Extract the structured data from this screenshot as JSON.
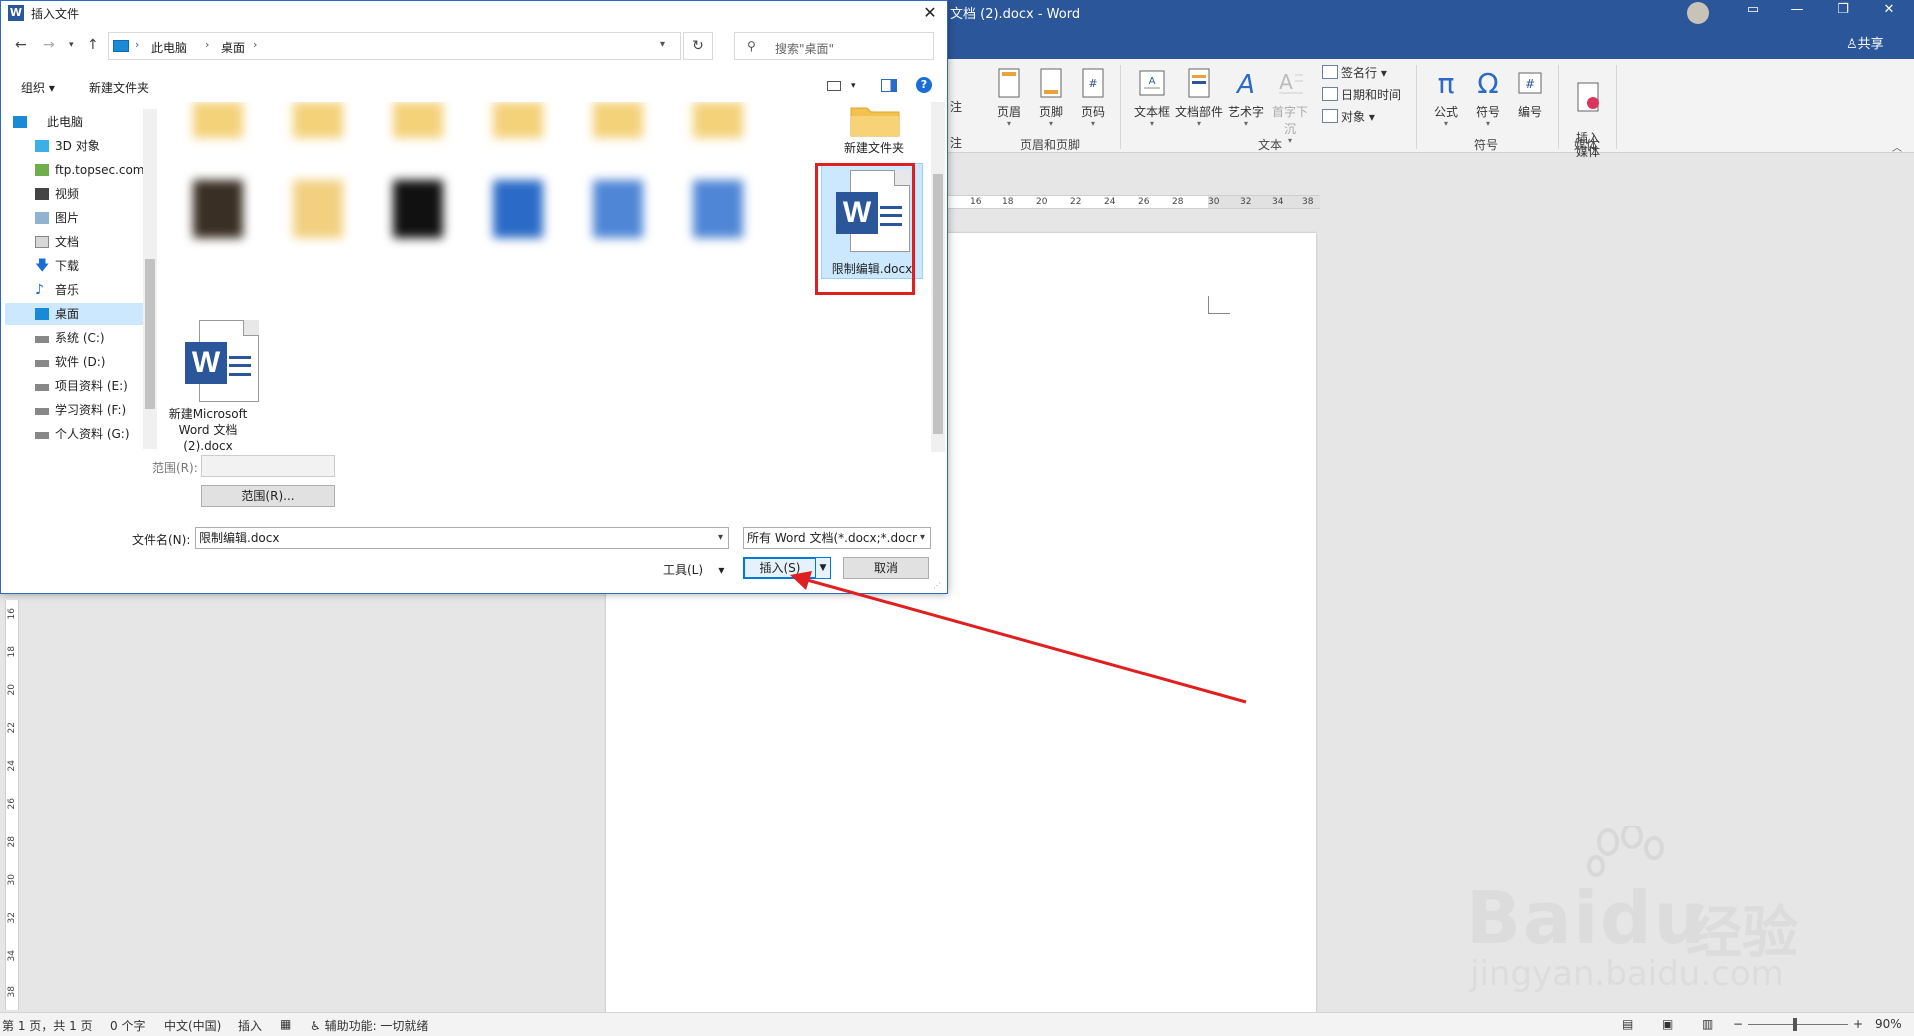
{
  "word": {
    "title": "文档 (2).docx  -  Word",
    "share": "♙共享",
    "ribbon": {
      "partial_1": "注",
      "partial_2": "注",
      "header": "页眉",
      "footer": "页脚",
      "page_number": "页码",
      "group_header_footer": "页眉和页脚",
      "textbox": "文本框",
      "quick_parts": "文档部件",
      "wordart": "艺术字",
      "dropcap": "首字下沉",
      "signature_line": "签名行",
      "date_time": "日期和时间",
      "object": "对象",
      "group_text": "文本",
      "equation": "公式",
      "symbol": "符号",
      "number": "编号",
      "group_symbols": "符号",
      "insert_media": "插入\n媒体",
      "group_media": "媒体"
    },
    "ruler_h": [
      "16",
      "18",
      "20",
      "22",
      "24",
      "26",
      "28",
      "30",
      "32",
      "34",
      "38"
    ],
    "ruler_v": [
      "16",
      "18",
      "20",
      "22",
      "24",
      "26",
      "28",
      "30",
      "32",
      "34",
      "38"
    ],
    "status": {
      "page": "第 1 页，共 1 页",
      "words": "0 个字",
      "language": "中文(中国)",
      "mode": "插入",
      "accessibility": "辅助功能: 一切就绪",
      "zoom": "90%"
    }
  },
  "dialog": {
    "title": "插入文件",
    "close": "✕",
    "breadcrumb": [
      "此电脑",
      "桌面"
    ],
    "search_placeholder": "搜索\"桌面\"",
    "cmd_organize": "组织 ▾",
    "cmd_new_folder": "新建文件夹",
    "nav_tree": [
      {
        "label": "此电脑",
        "icon": "pc-icon"
      },
      {
        "label": "3D 对象",
        "icon": "cube-icon"
      },
      {
        "label": "ftp.topsec.com",
        "icon": "network-icon"
      },
      {
        "label": "视频",
        "icon": "video-icon"
      },
      {
        "label": "图片",
        "icon": "picture-icon"
      },
      {
        "label": "文档",
        "icon": "document-icon"
      },
      {
        "label": "下载",
        "icon": "download-icon"
      },
      {
        "label": "音乐",
        "icon": "music-icon"
      },
      {
        "label": "桌面",
        "icon": "desktop-icon",
        "selected": true
      },
      {
        "label": "系统 (C:)",
        "icon": "drive-icon"
      },
      {
        "label": "软件 (D:)",
        "icon": "drive-icon"
      },
      {
        "label": "项目资料 (E:)",
        "icon": "drive-icon"
      },
      {
        "label": "学习资料 (F:)",
        "icon": "drive-icon"
      },
      {
        "label": "个人资料 (G:)",
        "icon": "drive-icon"
      }
    ],
    "files": {
      "new_folder": "新建文件夹",
      "selected_file": "限制编辑.docx",
      "new_word_doc": "新建Microsoft\nWord 文档\n(2).docx"
    },
    "range_label": "范围(R):",
    "range_button": "范围(R)...",
    "filename_label": "文件名(N):",
    "filename_value": "限制编辑.docx",
    "filetype_value": "所有 Word 文档(*.docx;*.docr",
    "tools": "工具(L)",
    "insert": "插入(S)",
    "cancel": "取消"
  },
  "watermark": {
    "brand": "Bai",
    "brand2": "du",
    "jingyan": "经验",
    "url": "jingyan.baidu.com"
  },
  "colors": {
    "word_blue": "#2b579a",
    "selection": "#cce8ff",
    "highlight_red": "#e02020",
    "primary_border": "#0078d7"
  }
}
